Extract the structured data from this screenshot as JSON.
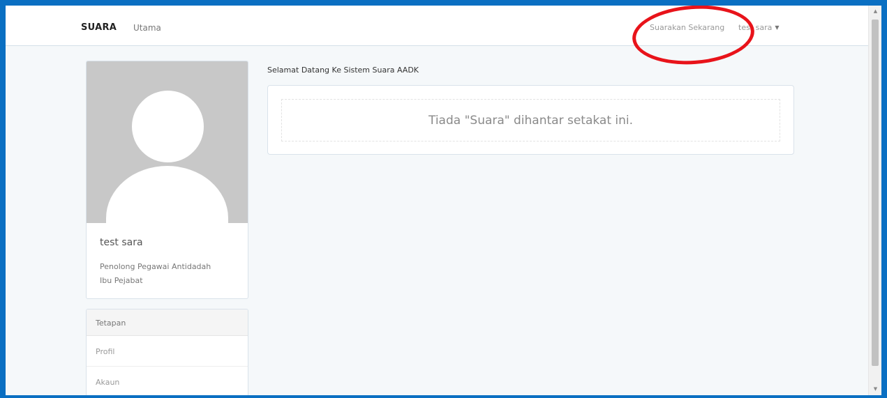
{
  "navbar": {
    "brand": "SUARA",
    "home_link": "Utama",
    "submit_link": "Suarakan Sekarang",
    "user_menu": "test sara",
    "caret_icon": "▼"
  },
  "highlight": {
    "color": "#e8131a"
  },
  "profile": {
    "name": "test sara",
    "role_line1": "Penolong Pegawai Antidadah",
    "role_line2": "Ibu Pejabat",
    "avatar_icon": "default-user-avatar"
  },
  "settings": {
    "heading": "Tetapan",
    "items": [
      "Profil",
      "Akaun"
    ]
  },
  "main": {
    "welcome": "Selamat Datang Ke Sistem Suara AADK",
    "empty_message": "Tiada \"Suara\" dihantar setakat ini."
  },
  "scrollbar": {
    "up_icon": "▲",
    "down_icon": "▼"
  },
  "colors": {
    "frame_border": "#0a6fc2",
    "background": "#f5f8fa"
  }
}
